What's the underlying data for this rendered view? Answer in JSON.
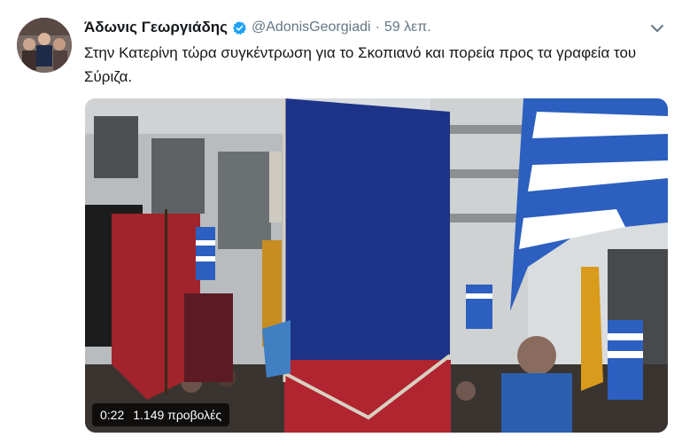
{
  "tweet": {
    "display_name": "Άδωνις Γεωργιάδης",
    "handle": "@AdonisGeorgiadi",
    "separator": "·",
    "time": "59 λεπ.",
    "text": "Στην Κατερίνη τώρα συγκέντρωση για το Σκοπιανό και πορεία προς τα γραφεία του Σύριζα."
  },
  "video": {
    "duration": "0:22",
    "views": "1.149 προβολές"
  },
  "icons": {
    "verified": "verified-badge-icon",
    "more": "chevron-down-icon"
  },
  "colors": {
    "verified": "#1da1f2",
    "secondary_text": "#657786",
    "primary_text": "#14171a"
  }
}
